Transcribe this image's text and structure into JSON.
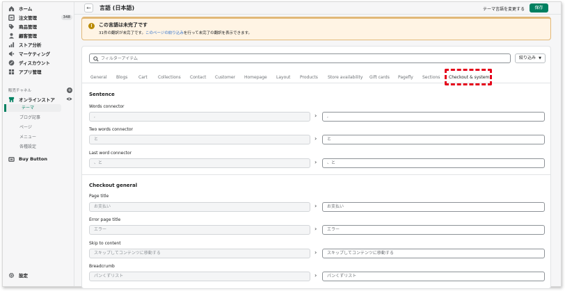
{
  "sidebar": {
    "items": [
      {
        "label": "ホーム",
        "icon": "home-icon"
      },
      {
        "label": "注文管理",
        "icon": "orders-icon",
        "badge": "348"
      },
      {
        "label": "商品管理",
        "icon": "tag-icon"
      },
      {
        "label": "顧客管理",
        "icon": "customer-icon"
      },
      {
        "label": "ストア分析",
        "icon": "analytics-icon"
      },
      {
        "label": "マーケティング",
        "icon": "marketing-icon"
      },
      {
        "label": "ディスカウント",
        "icon": "discount-icon"
      },
      {
        "label": "アプリ管理",
        "icon": "apps-icon"
      }
    ],
    "sales_channels_label": "販売チャネル",
    "online_store_label": "オンラインストア",
    "sub_items": [
      "テーマ",
      "ブログ記事",
      "ページ",
      "メニュー",
      "各種設定"
    ],
    "buy_button_label": "Buy Button",
    "settings_label": "設定"
  },
  "topbar": {
    "title": "言語 (日本語)",
    "change_lang": "テーマ言語を変更する",
    "save": "保存"
  },
  "banner": {
    "title": "この言語は未完了です",
    "text_before": "31件の翻訳が未完了です。",
    "link": "このページの絞り込み",
    "text_after": "を行って未完了の翻訳を表示できます。"
  },
  "filter": {
    "placeholder": "フィルターアイテム",
    "button": "絞り込み"
  },
  "tabs": [
    "General",
    "Blogs",
    "Cart",
    "Collections",
    "Contact",
    "Customer",
    "Homepage",
    "Layout",
    "Products",
    "Store availability",
    "Gift cards",
    "Pagefly",
    "Sections",
    "Checkout & system"
  ],
  "active_tab": "Checkout & system",
  "groups": [
    {
      "title": "Sentence",
      "fields": [
        {
          "label": "Words connector",
          "source": ",",
          "value": ","
        },
        {
          "label": "Two words connector",
          "source": "と",
          "value": "と"
        },
        {
          "label": "Last word connector",
          "source": "、と",
          "value": "、と"
        }
      ]
    },
    {
      "title": "Checkout general",
      "fields": [
        {
          "label": "Page title",
          "source": "お支払い",
          "value": "お支払い"
        },
        {
          "label": "Error page title",
          "source": "エラー",
          "value": "エラー"
        },
        {
          "label": "Skip to content",
          "source": "スキップしてコンテンツに移動する",
          "value": "スキップしてコンテンツに移動する"
        },
        {
          "label": "Breadcrumb",
          "source": "パンくずリスト",
          "value": "パンくずリスト"
        }
      ]
    }
  ],
  "colors": {
    "accent": "#008060",
    "warning_bg": "#fff4e4",
    "highlight": "#e5001a"
  }
}
